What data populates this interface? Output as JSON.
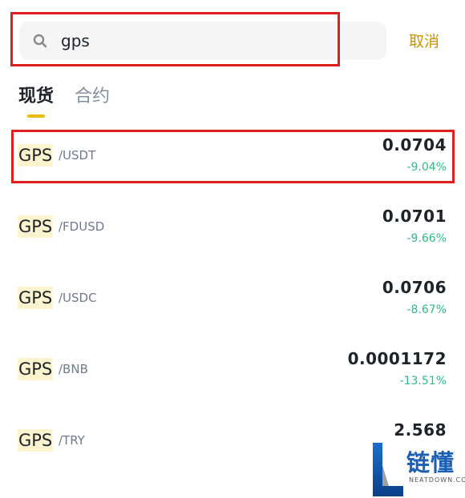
{
  "search": {
    "value": "gps",
    "placeholder": "",
    "cancel_label": "取消"
  },
  "tabs": [
    {
      "label": "现货",
      "active": true
    },
    {
      "label": "合约",
      "active": false
    }
  ],
  "colors": {
    "accent": "#f0b90b",
    "positive": "#2ebd85",
    "highlight_box": "#e01e1e",
    "cancel": "#c99400"
  },
  "results": [
    {
      "base": "GPS",
      "quote": "/USDT",
      "price": "0.0704",
      "change": "-9.04%"
    },
    {
      "base": "GPS",
      "quote": "/FDUSD",
      "price": "0.0701",
      "change": "-9.66%"
    },
    {
      "base": "GPS",
      "quote": "/USDC",
      "price": "0.0706",
      "change": "-8.67%"
    },
    {
      "base": "GPS",
      "quote": "/BNB",
      "price": "0.0001172",
      "change": "-13.51%"
    },
    {
      "base": "GPS",
      "quote": "/TRY",
      "price": "2.568",
      "change": ""
    }
  ],
  "watermark": {
    "title": "链懂",
    "subtitle": "NEATDOWN.COM"
  }
}
